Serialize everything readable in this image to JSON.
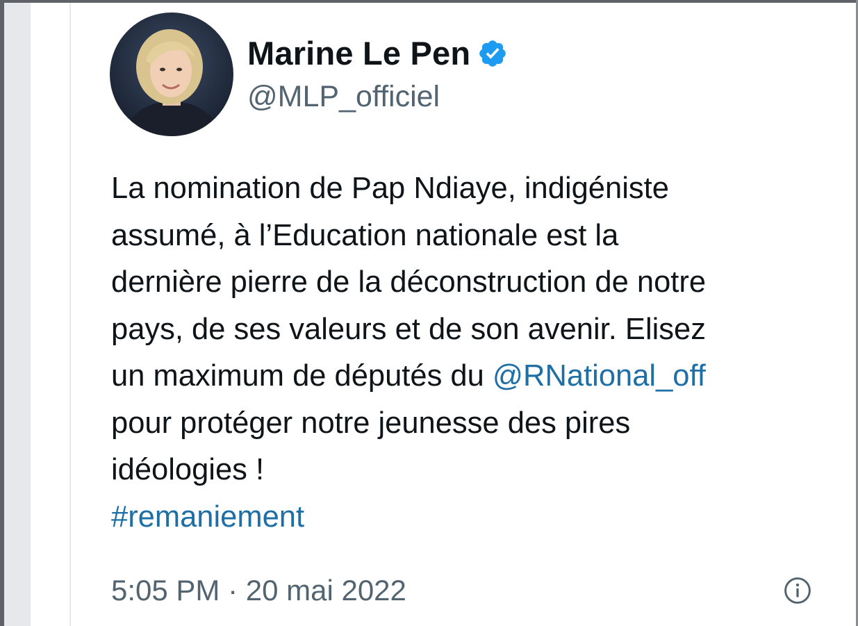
{
  "tweet": {
    "author_name": "Marine Le Pen",
    "handle": "@MLP_officiel",
    "verified_icon": "verified-badge-icon",
    "text_lines": [
      "La nomination de Pap Ndiaye, indigéniste",
      "assumé, à l’Education nationale est la",
      "dernière pierre de la déconstruction de notre",
      "pays, de ses valeurs et de son avenir. Elisez",
      "un maximum de députés du ",
      "pour protéger notre jeunesse des pires",
      "idéologies !"
    ],
    "mention": "@RNational_off",
    "hashtag": "#remaniement",
    "timestamp": "5:05 PM · 20 mai 2022",
    "info_icon": "info-icon"
  },
  "colors": {
    "text": "#0f1419",
    "secondary": "#536471",
    "link": "#1d6fa5",
    "verified": "#1d9bf0"
  }
}
